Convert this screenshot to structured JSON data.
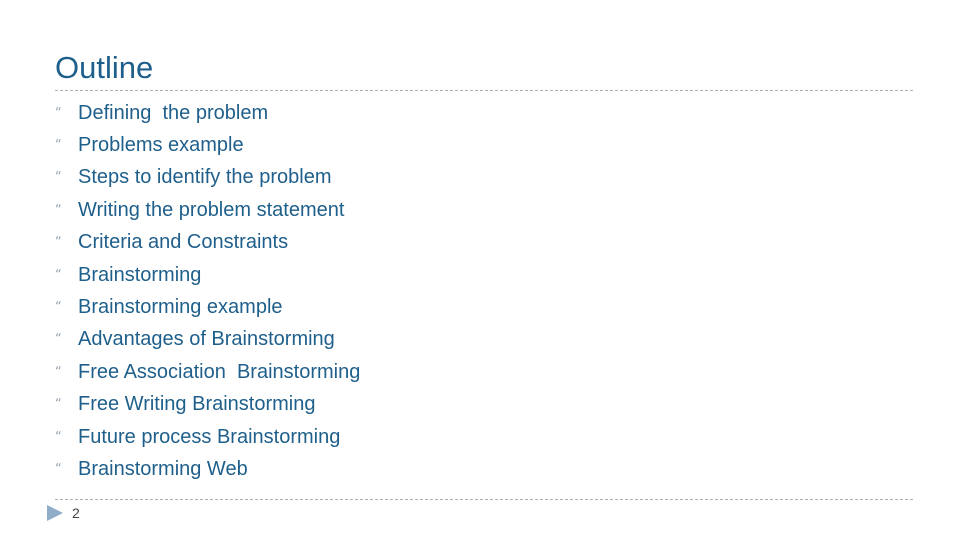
{
  "slide": {
    "title": "Outline",
    "bullet_icon": "quote-bullet-icon",
    "bullet_glyph": "“",
    "items": [
      "Defining  the problem",
      "Problems example",
      "Steps to identify the problem",
      "Writing the problem statement",
      "Criteria and Constraints",
      "Brainstorming",
      "Brainstorming example",
      "Advantages of Brainstorming",
      "Free Association  Brainstorming",
      "Free Writing Brainstorming",
      "Future process Brainstorming",
      "Brainstorming Web"
    ],
    "page_number": "2",
    "colors": {
      "title": "#1f5f8b",
      "text": "#1f5f8b",
      "bullet": "#9aa6b0",
      "footer_arrow": "#8fadc8",
      "rule": "#b0b0b0"
    }
  }
}
